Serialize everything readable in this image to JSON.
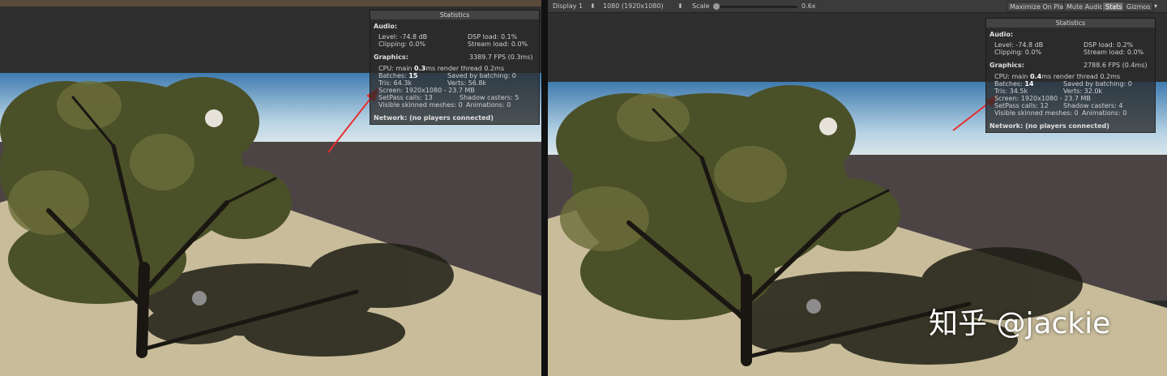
{
  "toolbar": {
    "display": "Display 1",
    "resolution": "1080 (1920x1080)",
    "scale_label": "Scale",
    "scale_value": "0.6x",
    "maximize": "Maximize On Play",
    "mute": "Mute Audio",
    "stats": "Stats",
    "gizmos": "Gizmos"
  },
  "left_stats": {
    "title": "Statistics",
    "audio_header": "Audio:",
    "level": "Level: -74.8 dB",
    "dsp": "DSP load: 0.1%",
    "clipping": "Clipping: 0.0%",
    "stream": "Stream load: 0.0%",
    "graphics_header": "Graphics:",
    "fps": "3389.7 FPS (0.3ms)",
    "cpu_prefix": "CPU: main",
    "cpu_main": "0.3",
    "cpu_suffix": "ms  render thread 0.2ms",
    "batches_prefix": "Batches:",
    "batches": "15",
    "saved": "Saved by batching: 0",
    "tris": "Tris: 64.3k",
    "verts": "Verts: 56.8k",
    "screen": "Screen: 1920x1080 - 23.7 MB",
    "setpass": "SetPass calls: 13",
    "shadow": "Shadow casters: 5",
    "skinned": "Visible skinned meshes: 0",
    "animations": "Animations: 0",
    "network": "Network: (no players connected)"
  },
  "right_stats": {
    "title": "Statistics",
    "audio_header": "Audio:",
    "level": "Level: -74.8 dB",
    "dsp": "DSP load: 0.2%",
    "clipping": "Clipping: 0.0%",
    "stream": "Stream load: 0.0%",
    "graphics_header": "Graphics:",
    "fps": "2788.6 FPS (0.4ms)",
    "cpu_prefix": "CPU: main",
    "cpu_main": "0.4",
    "cpu_suffix": "ms  render thread 0.2ms",
    "batches_prefix": "Batches:",
    "batches": "14",
    "saved": "Saved by batching: 0",
    "tris": "Tris: 34.5k",
    "verts": "Verts: 32.0k",
    "screen": "Screen: 1920x1080 - 23.7 MB",
    "setpass": "SetPass calls: 12",
    "shadow": "Shadow casters: 4",
    "skinned": "Visible skinned meshes: 0",
    "animations": "Animations: 0",
    "network": "Network: (no players connected)"
  },
  "watermark": "知乎 @jackie"
}
